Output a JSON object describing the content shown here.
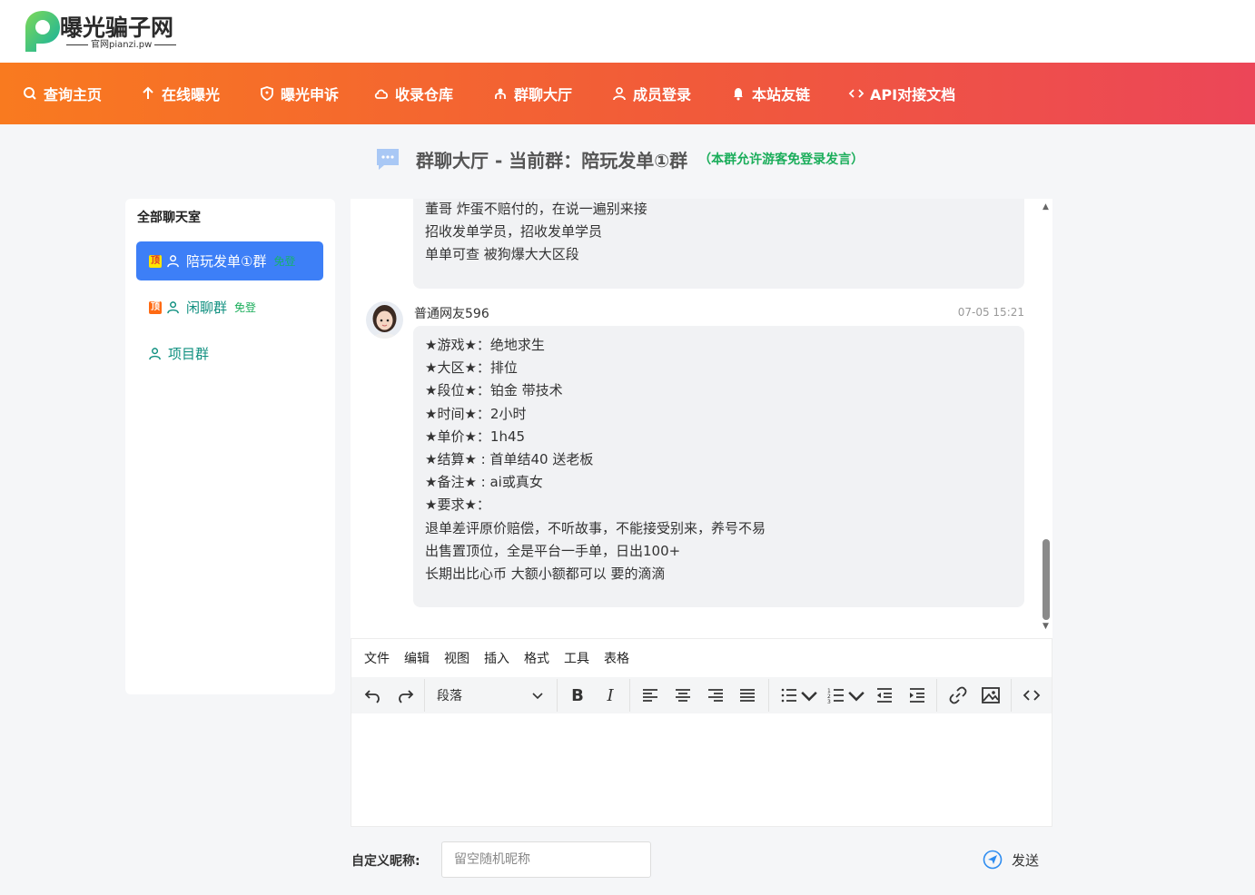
{
  "logo": {
    "title": "曝光骗子网",
    "subtitle": "官网pianzi.pw"
  },
  "nav": [
    {
      "label": "查询主页",
      "icon": "search-icon"
    },
    {
      "label": "在线曝光",
      "icon": "arrow-up-icon"
    },
    {
      "label": "曝光申诉",
      "icon": "shield-icon"
    },
    {
      "label": "收录仓库",
      "icon": "cloud-icon"
    },
    {
      "label": "群聊大厅",
      "icon": "group-icon"
    },
    {
      "label": "成员登录",
      "icon": "user-icon"
    },
    {
      "label": "本站友链",
      "icon": "bell-icon"
    },
    {
      "label": "API对接文档",
      "icon": "code-icon"
    }
  ],
  "page": {
    "title": "群聊大厅 - 当前群：陪玩发单①群",
    "note": "（本群允许游客免登录发言）"
  },
  "sidebar": {
    "heading": "全部聊天室",
    "rooms": [
      {
        "tag": "顶",
        "name": "陪玩发单①群",
        "free": "免登",
        "active": true
      },
      {
        "tag": "顶",
        "name": "闲聊群",
        "free": "免登",
        "active": false
      },
      {
        "tag": "",
        "name": "项目群",
        "free": "",
        "active": false
      }
    ]
  },
  "messages": [
    {
      "lines": [
        "董哥 炸蛋不赔付的，在说一遍别来接",
        "招收发单学员，招收发单学员",
        "单单可查 被狗爆大大区段"
      ]
    },
    {
      "name": "普通网友596",
      "time": "07-05 15:21",
      "lines": [
        "★游戏★：绝地求生",
        "★大区★：排位",
        "★段位★：铂金 带技术",
        "★时间★：2小时",
        "★单价★：1h45",
        "★结算★ : 首单结40 送老板",
        "★备注★ : ai或真女",
        "★要求★：",
        "退单差评原价赔偿，不听故事，不能接受别来，养号不易",
        "出售置顶位，全是平台一手单，日出100+",
        "长期出比心币 大额小额都可以 要的滴滴"
      ]
    }
  ],
  "editor": {
    "menu": [
      "文件",
      "编辑",
      "视图",
      "插入",
      "格式",
      "工具",
      "表格"
    ],
    "block_format": "段落"
  },
  "footer": {
    "nick_label": "自定义昵称:",
    "nick_placeholder": "留空随机昵称",
    "send_label": "发送"
  },
  "colors": {
    "nav_start": "#f97a1f",
    "nav_end": "#ec4658",
    "active_room": "#3d7ff7",
    "free_green": "#1aad5a"
  }
}
